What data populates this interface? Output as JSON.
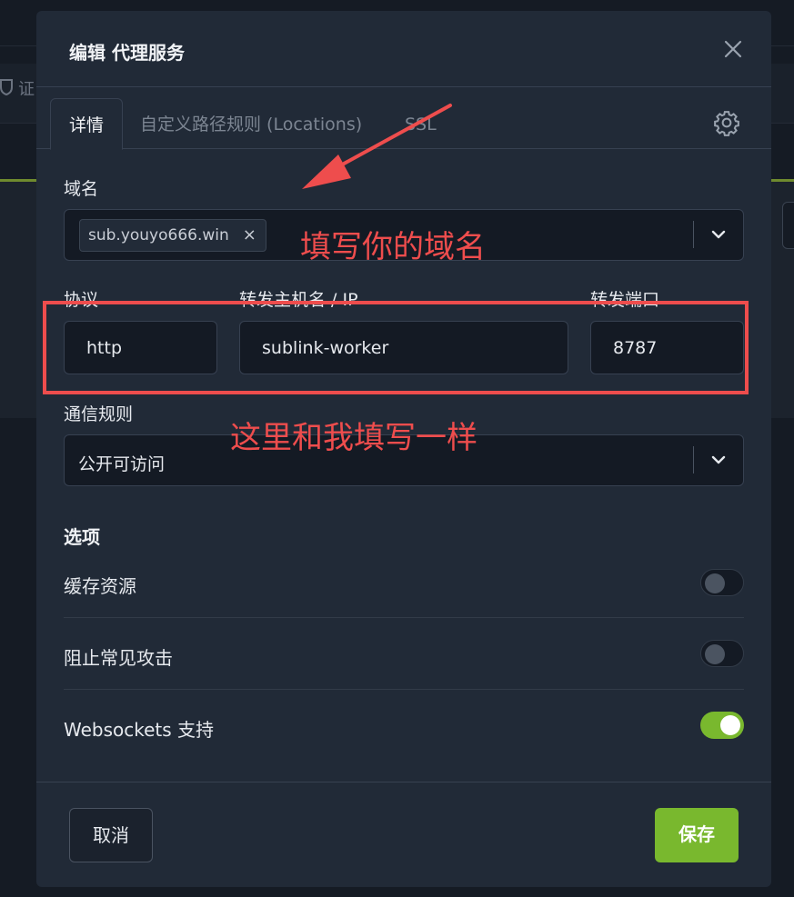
{
  "background": {
    "partial_text": "证"
  },
  "modal": {
    "title": "编辑 代理服务",
    "tabs": [
      {
        "label": "详情"
      },
      {
        "label": "自定义路径规则 (Locations)"
      },
      {
        "label": "SSL"
      }
    ],
    "domain": {
      "label": "域名",
      "chips": [
        "sub.youyo666.win"
      ],
      "chip_remove": "×"
    },
    "protocol": {
      "label": "协议",
      "value": "http"
    },
    "forward_host": {
      "label": "转发主机名 / IP",
      "value": "sublink-worker"
    },
    "forward_port": {
      "label": "转发端口",
      "value": "8787"
    },
    "access_rule": {
      "label": "通信规则",
      "value": "公开可访问"
    },
    "options": {
      "title": "选项",
      "items": [
        {
          "label": "缓存资源",
          "enabled": false
        },
        {
          "label": "阻止常见攻击",
          "enabled": false
        },
        {
          "label": "Websockets 支持",
          "enabled": true
        }
      ]
    },
    "buttons": {
      "cancel": "取消",
      "save": "保存"
    }
  },
  "annotations": {
    "domain_hint": "填写你的域名",
    "same_hint": "这里和我填写一样",
    "color": "#ee4d4d"
  },
  "colors": {
    "accent": "#79b82e",
    "modal_bg": "#212a37",
    "input_bg": "#141a24"
  }
}
